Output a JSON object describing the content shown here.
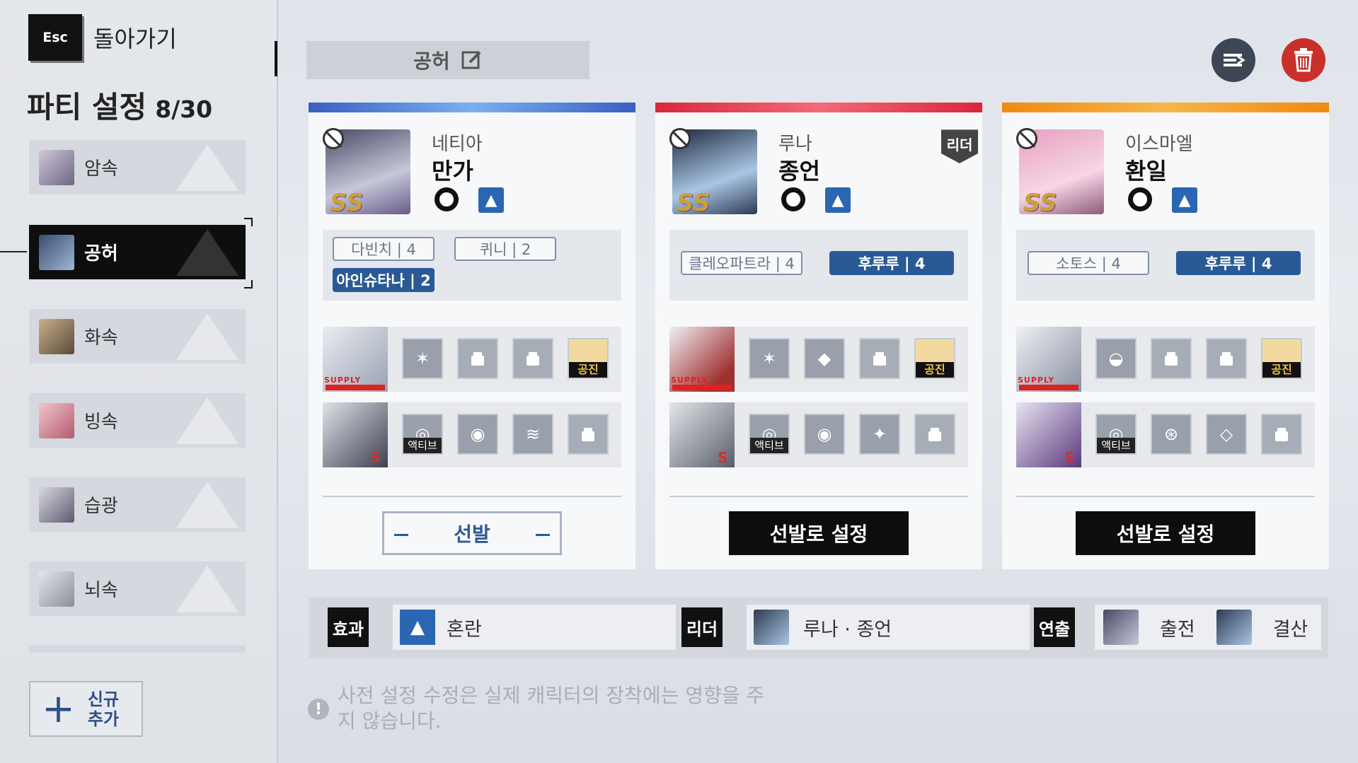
{
  "sidebar": {
    "esc_label": "Esc",
    "back_label": "돌아가기",
    "title": "파티 설정",
    "count": "8/30",
    "items": [
      {
        "label": "암속"
      },
      {
        "label": "공허"
      },
      {
        "label": "화속"
      },
      {
        "label": "빙속"
      },
      {
        "label": "습광"
      },
      {
        "label": "뇌속"
      }
    ],
    "new_label": "신규 추가"
  },
  "header": {
    "party_name": "공허",
    "edit_icon": "edit-icon",
    "sort_icon": "sort-icon",
    "delete_icon": "trash-icon"
  },
  "cards": [
    {
      "subname": "네티아",
      "name": "만가",
      "rank": "SS",
      "tags": [
        {
          "label": "다빈치 | 4"
        },
        {
          "label": "퀴니 | 2"
        },
        {
          "label": "아인슈타나 | 2"
        }
      ],
      "partner_label": "공진",
      "active_label": "액티브",
      "button": "선발",
      "accent": "#4a86e0"
    },
    {
      "subname": "루나",
      "name": "종언",
      "rank": "SS",
      "leader_badge": "리더",
      "tags": [
        {
          "label": "클레오파트라 | 4"
        },
        {
          "label": "후루루 | 4"
        }
      ],
      "partner_label": "공진",
      "active_label": "액티브",
      "button": "선발로 설정",
      "accent": "#e03a4a"
    },
    {
      "subname": "이스마엘",
      "name": "환일",
      "rank": "SS",
      "tags": [
        {
          "label": "소토스 | 4"
        },
        {
          "label": "후루루 | 4"
        }
      ],
      "partner_label": "공진",
      "active_label": "액티브",
      "button": "선발로 설정",
      "accent": "#f39a1e"
    }
  ],
  "info_bar": {
    "effect_key": "효과",
    "effect_value": "혼란",
    "leader_key": "리더",
    "leader_value": "루나 · 종언",
    "show_key": "연출",
    "show_value1": "출전",
    "show_value2": "결산"
  },
  "notice": "사전 설정 수정은 실제 캐릭터의 장착에는 영향을 주지 않습니다."
}
